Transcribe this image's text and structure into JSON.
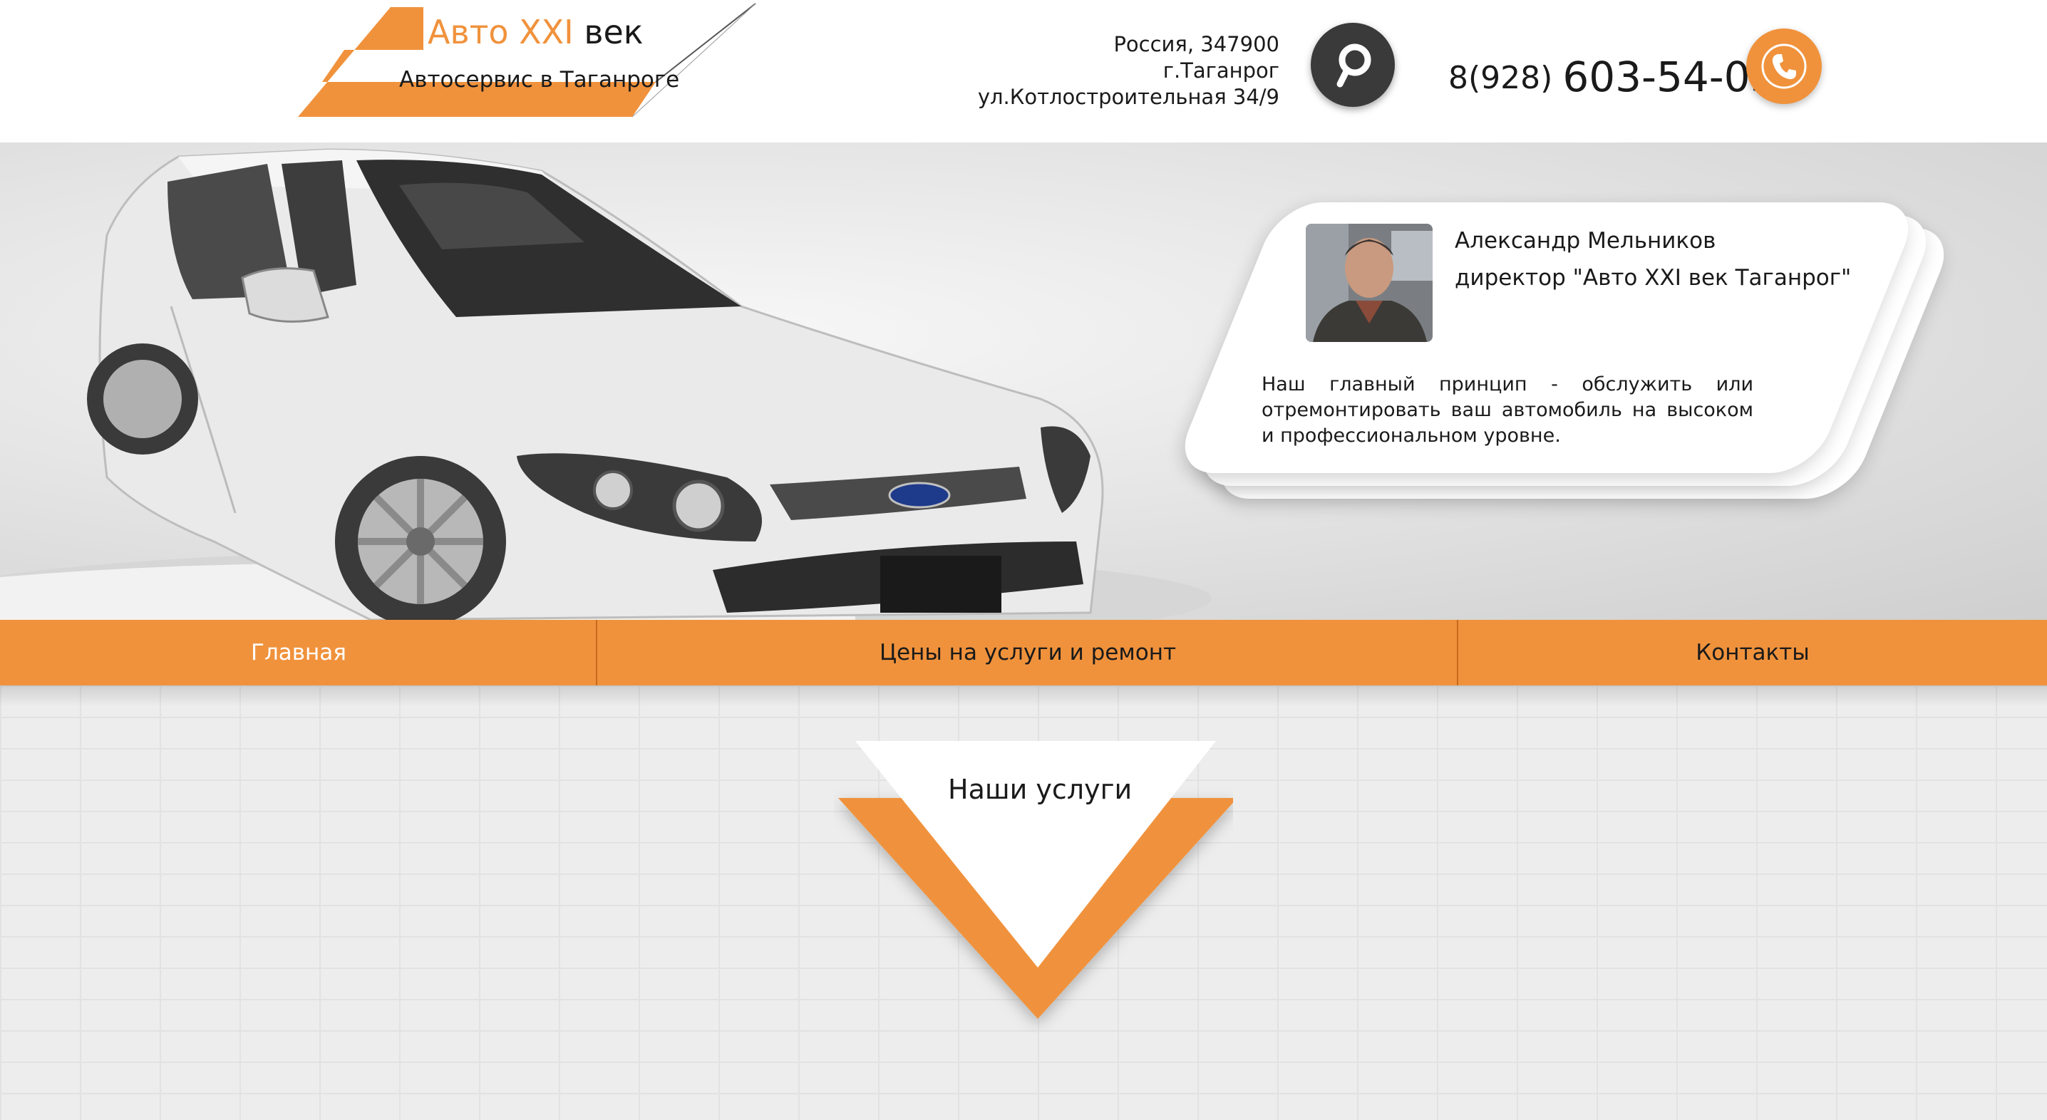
{
  "brand": {
    "name_accent": "Авто XXI",
    "name_dark": "век",
    "subtitle": "Автосервис в Таганроге",
    "accent_color": "#f0923c"
  },
  "contact": {
    "address_lines": [
      "Россия, 347900",
      "г.Таганрог",
      "ул.Котлостроительная 34/9"
    ],
    "location_icon": "map-pin-icon",
    "phone_prefix": "8(928)",
    "phone_main": "603-54-03",
    "phone_icon": "phone-icon"
  },
  "hero": {
    "director_name": "Александр Мельников",
    "director_role": "директор \"Авто XXI век Таганрог\"",
    "principle": "Наш главный принцип - обслужить или отремонтировать ваш автомобиль на высоком и профессиональном уровне."
  },
  "nav": {
    "items": [
      {
        "label": "Главная",
        "active": true
      },
      {
        "label": "Цены на услуги и ремонт",
        "active": false
      },
      {
        "label": "Контакты",
        "active": false
      }
    ]
  },
  "services": {
    "title": "Наши услуги"
  }
}
